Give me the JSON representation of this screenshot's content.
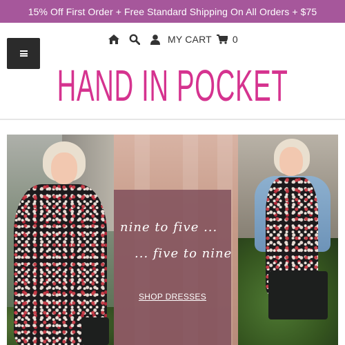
{
  "promo": {
    "text": "15% Off First Order + Free Standard Shipping On All Orders + $75"
  },
  "header": {
    "cart_label": "MY CART",
    "cart_count": "0",
    "icons": [
      "home-icon",
      "search-icon",
      "user-icon",
      "cart-icon"
    ],
    "menu_icon": "hamburger-menu-icon"
  },
  "logo": {
    "text": "HAND IN POCKET"
  },
  "hero": {
    "tagline_line1": "nine to five ...",
    "tagline_line2": "... five to nine",
    "cta_label": "SHOP DRESSES"
  },
  "colors": {
    "promo_bg": "#a6579b",
    "logo": "#d5338f",
    "overlay": "#80505c",
    "menu_button": "#2b2b2b"
  }
}
